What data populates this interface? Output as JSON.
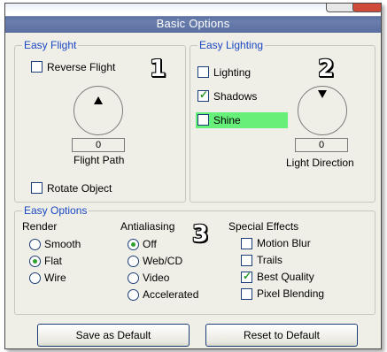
{
  "window": {
    "title": "Basic Options"
  },
  "easy_flight": {
    "legend": "Easy Flight",
    "reverse_flight": {
      "label": "Reverse Flight",
      "checked": false
    },
    "dial_value": "0",
    "dial_label": "Flight Path",
    "rotate_object": {
      "label": "Rotate Object",
      "checked": false
    },
    "marker": "1"
  },
  "easy_lighting": {
    "legend": "Easy Lighting",
    "lighting": {
      "label": "Lighting",
      "checked": false
    },
    "shadows": {
      "label": "Shadows",
      "checked": true
    },
    "shine": {
      "label": "Shine",
      "checked": false,
      "highlight_color": "#66f07a"
    },
    "dial_value": "0",
    "dial_label": "Light Direction",
    "marker": "2"
  },
  "easy_options": {
    "legend": "Easy Options",
    "marker": "3",
    "render": {
      "heading": "Render",
      "options": [
        {
          "label": "Smooth",
          "selected": false
        },
        {
          "label": "Flat",
          "selected": true
        },
        {
          "label": "Wire",
          "selected": false
        }
      ]
    },
    "antialiasing": {
      "heading": "Antialiasing",
      "options": [
        {
          "label": "Off",
          "selected": true
        },
        {
          "label": "Web/CD",
          "selected": false
        },
        {
          "label": "Video",
          "selected": false
        },
        {
          "label": "Accelerated",
          "selected": false
        }
      ]
    },
    "special_effects": {
      "heading": "Special Effects",
      "options": [
        {
          "label": "Motion Blur",
          "checked": false
        },
        {
          "label": "Trails",
          "checked": false
        },
        {
          "label": "Best Quality",
          "checked": true
        },
        {
          "label": "Pixel Blending",
          "checked": false
        }
      ]
    }
  },
  "buttons": {
    "save_default": "Save as Default",
    "reset_default": "Reset to Default"
  },
  "colors": {
    "titlebar": "#5a6fa0",
    "legend_text": "#1a47c2",
    "radio_dot": "#2ea02e",
    "check_mark": "#2a9a2a",
    "panel_bg": "#f0efe7"
  }
}
